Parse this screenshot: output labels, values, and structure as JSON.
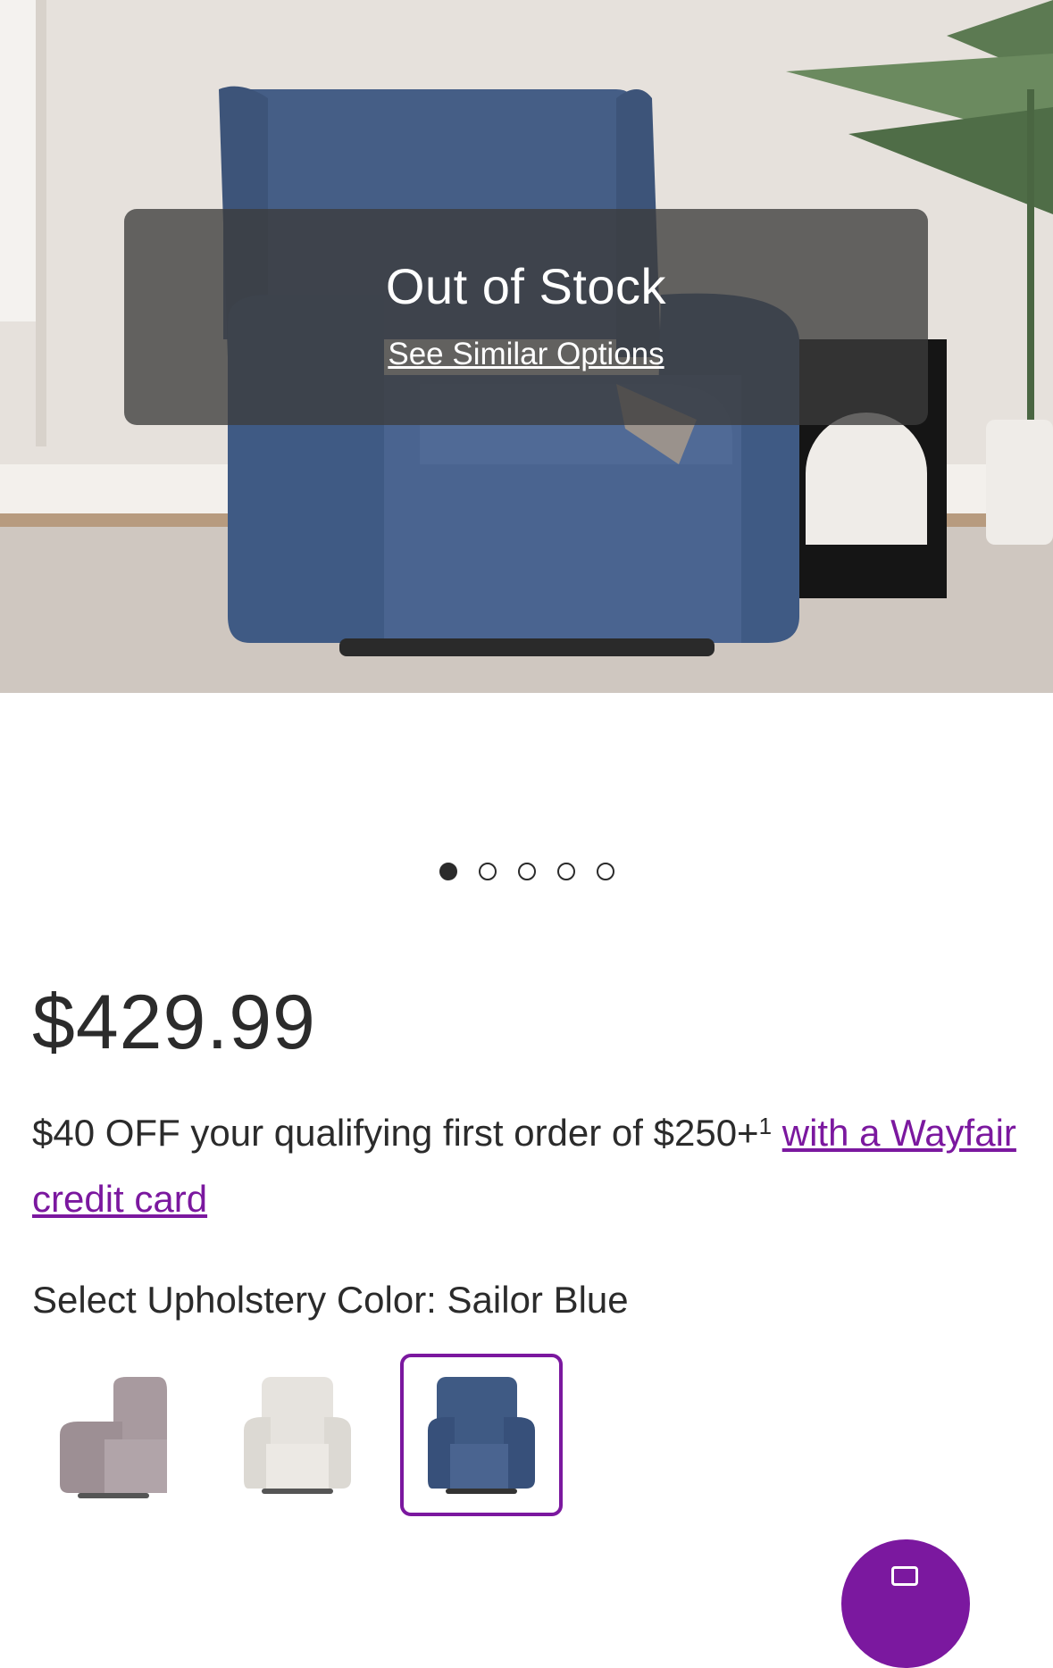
{
  "hero": {
    "overlay_title": "Out of Stock",
    "overlay_link": "See Similar Options"
  },
  "carousel": {
    "total": 5,
    "active_index": 0
  },
  "product": {
    "price": "$429.99",
    "promo_text": "$40 OFF your qualifying first order of $250+",
    "promo_footnote": "1",
    "promo_link": "with a Wayfair credit card",
    "select_prefix": "Select Upholstery Color:",
    "selected_color": "Sailor Blue"
  },
  "swatches": [
    {
      "name": "gray-chair-swatch",
      "color": "#a89a9f"
    },
    {
      "name": "white-chair-swatch",
      "color": "#e6e3de"
    },
    {
      "name": "sailor-blue-chair-swatch",
      "color": "#3f5a84",
      "selected": true
    }
  ],
  "colors": {
    "accent": "#7b189f",
    "text": "#2b2b2b",
    "overlay": "#3c3c3c"
  }
}
